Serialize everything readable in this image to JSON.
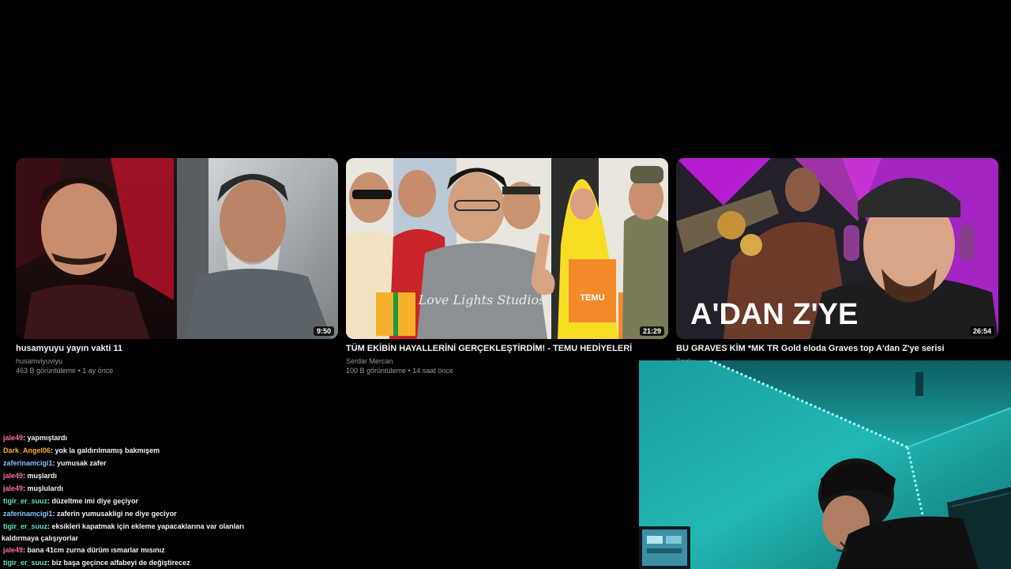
{
  "videos": [
    {
      "title": "husamyuyu yayın vakti 11",
      "channel": "husamviyuviyu",
      "meta": "463 B görüntüleme • 1 ay önce",
      "duration": "9:50"
    },
    {
      "title": "TÜM EKİBİN HAYALLERİNİ GERÇEKLEŞTİRDİM! - TEMU HEDİYELERİ",
      "channel": "Serdar Mercan",
      "meta": "100 B görüntüleme • 14 saat önce",
      "duration": "21:29"
    },
    {
      "title": "BU GRAVES KİM *MK TR Gold eloda Graves top A'dan Z'ye serisi",
      "channel": "Bosku",
      "meta": "",
      "duration": "26:54"
    }
  ],
  "thumb_text": {
    "v2_shirt": "Love Lights Studios",
    "v2_box": "TEMU",
    "v3_caption": "A'DAN Z'YE"
  },
  "chat": [
    {
      "user": "jale49",
      "color": "#ff6fa0",
      "text": ": yapmıştardı"
    },
    {
      "user": "Dark_Angel06",
      "color": "#ffb020",
      "text": ": yok la galdırılmamış bakmışem"
    },
    {
      "user": "zaferinamcigi1",
      "color": "#7ec8ff",
      "text": ": yumusak zafer"
    },
    {
      "user": "jale49",
      "color": "#ff6fa0",
      "text": ": muşlardı"
    },
    {
      "user": "jale49",
      "color": "#ff6fa0",
      "text": ": muşlulardı"
    },
    {
      "user": "tigir_er_suuz",
      "color": "#5fe0c8",
      "text": ": düzeltme imi diye geçiyor"
    },
    {
      "user": "zaferinamcigi1",
      "color": "#7ec8ff",
      "text": ": zaferin yumusakligi ne diye geciyor"
    },
    {
      "user": "tigir_er_suuz",
      "color": "#5fe0c8",
      "text": ": eksikleri kapatmak için ekleme yapacaklarına var olanları",
      "cont": "kaldırmaya çalışıyorlar"
    },
    {
      "user": "jale49",
      "color": "#ff6fa0",
      "text": ": bana 41cm zurna dürüm ısmarlar mısınız"
    },
    {
      "user": "tigir_er_suuz",
      "color": "#5fe0c8",
      "text": ": biz başa geçince alfabeyi de değiştirecez"
    }
  ]
}
